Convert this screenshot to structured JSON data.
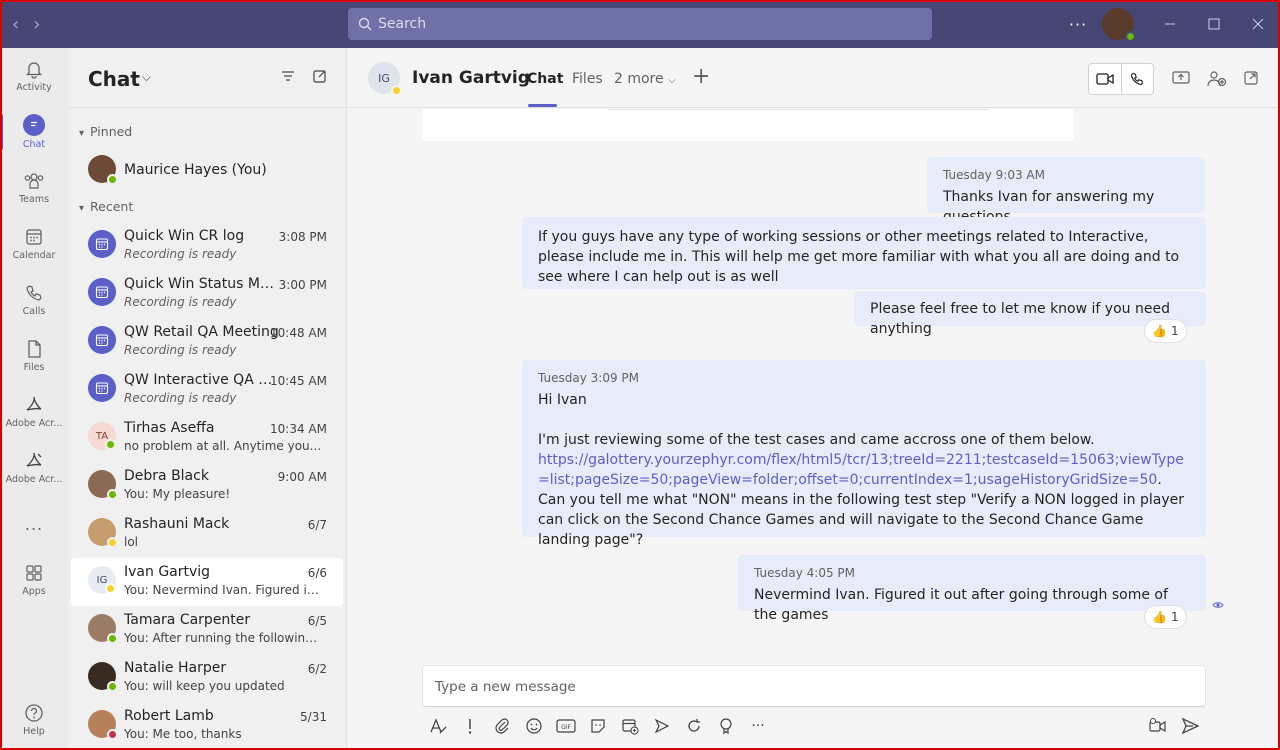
{
  "window": {
    "search_placeholder": "Search",
    "more_label": "···"
  },
  "rail": {
    "items": [
      {
        "label": "Activity"
      },
      {
        "label": "Chat"
      },
      {
        "label": "Teams"
      },
      {
        "label": "Calendar"
      },
      {
        "label": "Calls"
      },
      {
        "label": "Files"
      },
      {
        "label": "Adobe Acr..."
      },
      {
        "label": "Adobe Acr..."
      },
      {
        "label": "..."
      },
      {
        "label": "Apps"
      },
      {
        "label": "Help"
      }
    ]
  },
  "chat_list": {
    "title": "Chat",
    "pinned_label": "Pinned",
    "recent_label": "Recent",
    "pinned": [
      {
        "name": "Maurice Hayes (You)"
      }
    ],
    "recent": [
      {
        "name": "Quick Win CR log",
        "preview": "Recording is ready",
        "time": "3:08 PM",
        "initials": ""
      },
      {
        "name": "Quick Win Status Meet...",
        "preview": "Recording is ready",
        "time": "3:00 PM",
        "initials": ""
      },
      {
        "name": "QW Retail QA Meeting",
        "preview": "Recording is ready",
        "time": "10:48 AM",
        "initials": ""
      },
      {
        "name": "QW Interactive QA M...",
        "preview": "Recording is ready",
        "time": "10:45 AM",
        "initials": ""
      },
      {
        "name": "Tirhas Aseffa",
        "preview": "no problem at all. Anytime you...",
        "time": "10:34 AM",
        "initials": "TA"
      },
      {
        "name": "Debra Black",
        "preview": "You: My pleasure!",
        "time": "9:00 AM",
        "initials": ""
      },
      {
        "name": "Rashauni Mack",
        "preview": "lol",
        "time": "6/7",
        "initials": ""
      },
      {
        "name": "Ivan Gartvig",
        "preview": "You: Nevermind Ivan. Figured it o...",
        "time": "6/6",
        "initials": "IG"
      },
      {
        "name": "Tamara Carpenter",
        "preview": "You: After running the following q...",
        "time": "6/5",
        "initials": ""
      },
      {
        "name": "Natalie Harper",
        "preview": "You: will keep you updated",
        "time": "6/2",
        "initials": ""
      },
      {
        "name": "Robert Lamb",
        "preview": "You: Me too, thanks",
        "time": "5/31",
        "initials": ""
      }
    ]
  },
  "conversation": {
    "name": "Ivan Gartvig",
    "initials": "IG",
    "tabs": [
      {
        "label": "Chat"
      },
      {
        "label": "Files"
      },
      {
        "label": "2 more"
      }
    ],
    "messages": [
      {
        "timestamp": "Tuesday 9:03 AM",
        "text": "Thanks Ivan for answering my questions"
      },
      {
        "text": "If you guys have any type of working sessions or other meetings related to Interactive, please include me in. This will help me get more familiar with what you all are doing and to see where I can help out is as well"
      },
      {
        "text": "Please feel free to let me know if you need anything",
        "reaction": "👍",
        "reaction_count": "1"
      },
      {
        "timestamp": "Tuesday 3:09 PM",
        "line1": "Hi Ivan",
        "line2_pre": "I'm just reviewing some of the test cases and came accross one of them below.",
        "link": "https://galottery.yourzephyr.com/flex/html5/tcr/13;treeId=2211;testcaseId=15063;viewType=list;pageSize=50;pageView=folder;offset=0;currentIndex=1;usageHistoryGridSize=50",
        "line2_post": ". Can you tell me what \"NON\" means  in the following test step \"Verify a NON logged in player can click on the Second Chance Games and will navigate to the Second Chance Game landing page\"?"
      },
      {
        "timestamp": "Tuesday 4:05 PM",
        "text": "Nevermind Ivan. Figured it out after going through some of the games",
        "reaction": "👍",
        "reaction_count": "1"
      }
    ]
  },
  "compose": {
    "placeholder": "Type a new message"
  },
  "colors": {
    "titlebar": "#464775",
    "accent": "#5b5fc7",
    "bubble": "#e8ebfa",
    "available": "#6bb700",
    "away": "#f8d22a",
    "busy": "#c4314b"
  }
}
